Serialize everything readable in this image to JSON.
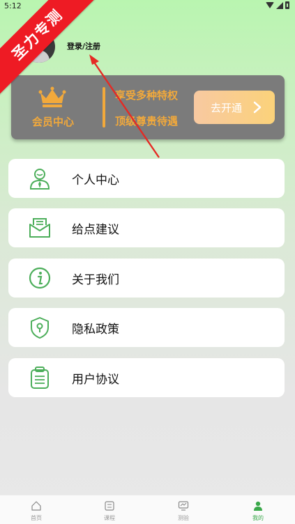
{
  "status_bar": {
    "time": "5:12"
  },
  "watermark": "圣力专测",
  "profile": {
    "login_label": "登录/注册"
  },
  "vip": {
    "title": "会员中心",
    "benefit_line1": "享受多种特权",
    "benefit_line2": "顶级尊贵待遇",
    "open_button": "去开通",
    "accent_color": "#f2a93b"
  },
  "menu": {
    "items": [
      {
        "label": "个人中心",
        "icon": "person-icon"
      },
      {
        "label": "给点建议",
        "icon": "mail-icon"
      },
      {
        "label": "关于我们",
        "icon": "info-icon"
      },
      {
        "label": "隐私政策",
        "icon": "shield-icon"
      },
      {
        "label": "用户协议",
        "icon": "clipboard-icon"
      }
    ],
    "icon_color": "#4cae5a"
  },
  "tabbar": {
    "tabs": [
      {
        "label": "首页",
        "icon": "home-icon"
      },
      {
        "label": "课程",
        "icon": "course-icon"
      },
      {
        "label": "测验",
        "icon": "monitor-icon"
      },
      {
        "label": "我的",
        "icon": "user-icon"
      }
    ],
    "active_color": "#3aa84a"
  }
}
